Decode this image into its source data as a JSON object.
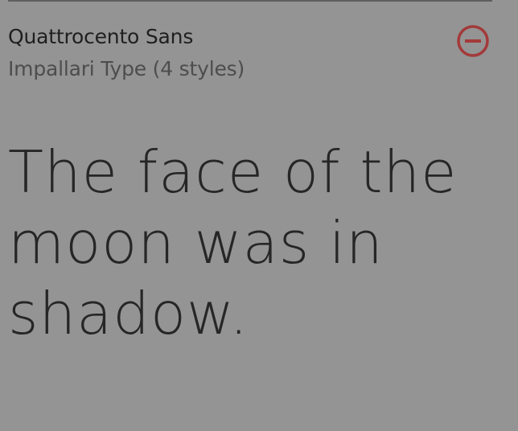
{
  "font": {
    "name": "Quattrocento Sans",
    "foundry": "Impallari Type (4 styles)"
  },
  "sample": {
    "line1": "The face of the",
    "line2": "moon was in",
    "line3": "shadow."
  },
  "icons": {
    "remove": "minus-circle-icon"
  },
  "colors": {
    "background": "#949494",
    "remove_icon": "#a33a3a",
    "sample_text": "#262626"
  }
}
